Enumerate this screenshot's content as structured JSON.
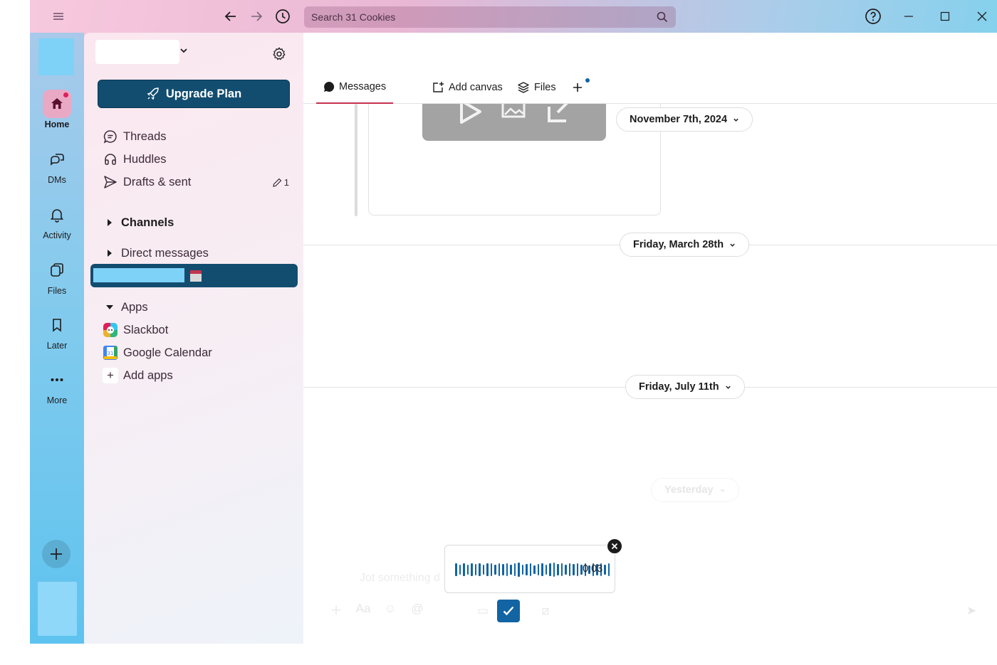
{
  "titlebar": {
    "search_placeholder": "Search 31 Cookies"
  },
  "rail": {
    "items": [
      {
        "label": "Home",
        "icon": "home-icon",
        "active": true
      },
      {
        "label": "DMs",
        "icon": "dms-icon"
      },
      {
        "label": "Activity",
        "icon": "bell-icon"
      },
      {
        "label": "Files",
        "icon": "files-icon"
      },
      {
        "label": "Later",
        "icon": "bookmark-icon"
      },
      {
        "label": "More",
        "icon": "more-icon"
      }
    ]
  },
  "sidebar": {
    "upgrade_label": "Upgrade Plan",
    "nav": [
      {
        "label": "Threads",
        "icon": "threads-icon"
      },
      {
        "label": "Huddles",
        "icon": "headphones-icon"
      },
      {
        "label": "Drafts & sent",
        "icon": "send-icon",
        "count": "1"
      }
    ],
    "channels_label": "Channels",
    "dm_label": "Direct messages",
    "apps_label": "Apps",
    "apps": [
      {
        "label": "Slackbot",
        "icon": "slackbot-icon"
      },
      {
        "label": "Google Calendar",
        "icon": "google-calendar-icon"
      }
    ],
    "add_apps_label": "Add apps",
    "add_apps_icon": "+"
  },
  "main": {
    "tabs": [
      {
        "label": "Messages",
        "icon": "message-bubble-icon",
        "active": true
      },
      {
        "label": "Add canvas",
        "icon": "canvas-icon"
      },
      {
        "label": "Files",
        "icon": "files-stack-icon"
      }
    ],
    "days": [
      {
        "label": "November 7th, 2024"
      },
      {
        "label": "Friday, March 28th"
      },
      {
        "label": "Friday, July 11th"
      },
      {
        "label": "Yesterday"
      }
    ],
    "composer_placeholder": "Jot something d",
    "clip_time": "0:03"
  },
  "colors": {
    "aubergine": "#124d70",
    "accent_red": "#c5304f",
    "link_blue": "#1264a3"
  }
}
